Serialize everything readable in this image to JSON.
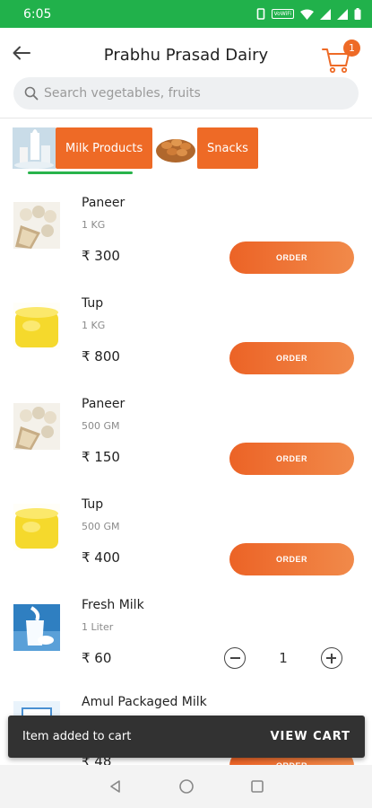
{
  "status_bar": {
    "time": "6:05",
    "network_badge": "VoWiFi"
  },
  "header": {
    "title": "Prabhu Prasad Dairy",
    "cart_count": "1"
  },
  "search": {
    "placeholder": "Search vegetables, fruits"
  },
  "categories": [
    {
      "label": "Milk Products",
      "selected": true
    },
    {
      "label": "Snacks",
      "selected": false
    }
  ],
  "currency": "₹",
  "order_label": "ORDER",
  "products": [
    {
      "name": "Paneer",
      "qty": "1 KG",
      "price": "₹ 300"
    },
    {
      "name": "Tup",
      "qty": "1 KG",
      "price": "₹ 800"
    },
    {
      "name": "Paneer",
      "qty": "500 GM",
      "price": "₹ 150"
    },
    {
      "name": "Tup",
      "qty": "500 GM",
      "price": "₹ 400"
    },
    {
      "name": "Fresh Milk",
      "qty": "1 Liter",
      "price": "₹ 60",
      "cart_quantity": "1"
    },
    {
      "name": "Amul Packaged Milk",
      "qty": "",
      "price": "₹ 48"
    }
  ],
  "snackbar": {
    "message": "Item added to cart",
    "action": "VIEW CART"
  },
  "colors": {
    "status_bar": "#21b14b",
    "accent": "#ee6a26",
    "tab_indicator": "#28b34b"
  }
}
